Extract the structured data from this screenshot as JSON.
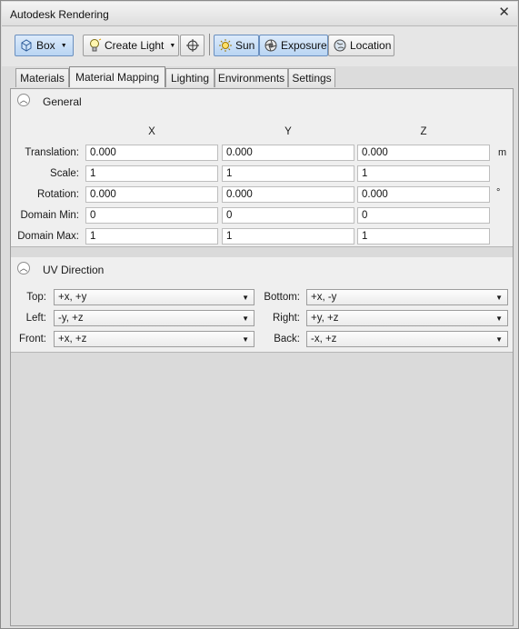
{
  "window": {
    "title": "Autodesk Rendering",
    "close_glyph": "✕"
  },
  "toolbar": {
    "box": {
      "label": "Box",
      "icon": "box-icon"
    },
    "create_light": {
      "label": "Create Light",
      "icon": "light-bulb-icon"
    },
    "target": {
      "icon": "crosshair-icon"
    },
    "sun": {
      "label": "Sun",
      "icon": "sun-icon"
    },
    "exposure": {
      "label": "Exposure",
      "icon": "exposure-icon"
    },
    "location": {
      "label": "Location",
      "icon": "globe-icon"
    }
  },
  "tabs": [
    {
      "label": "Materials",
      "selected": false
    },
    {
      "label": "Material Mapping",
      "selected": true
    },
    {
      "label": "Lighting",
      "selected": false
    },
    {
      "label": "Environments",
      "selected": false
    },
    {
      "label": "Settings",
      "selected": false
    }
  ],
  "general": {
    "title": "General",
    "axes": [
      "X",
      "Y",
      "Z"
    ],
    "rows": [
      {
        "label": "Translation:",
        "values": [
          "0.000",
          "0.000",
          "0.000"
        ],
        "unit": "m"
      },
      {
        "label": "Scale:",
        "values": [
          "1",
          "1",
          "1"
        ],
        "unit": ""
      },
      {
        "label": "Rotation:",
        "values": [
          "0.000",
          "0.000",
          "0.000"
        ],
        "unit": "°"
      },
      {
        "label": "Domain Min:",
        "values": [
          "0",
          "0",
          "0"
        ],
        "unit": ""
      },
      {
        "label": "Domain Max:",
        "values": [
          "1",
          "1",
          "1"
        ],
        "unit": ""
      }
    ]
  },
  "uv": {
    "title": "UV Direction",
    "top": {
      "label": "Top:",
      "value": "+x, +y"
    },
    "bottom": {
      "label": "Bottom:",
      "value": "+x, -y"
    },
    "left": {
      "label": "Left:",
      "value": "-y, +z"
    },
    "right": {
      "label": "Right:",
      "value": "+y, +z"
    },
    "front": {
      "label": "Front:",
      "value": "+x, +z"
    },
    "back": {
      "label": "Back:",
      "value": "-x, +z"
    }
  },
  "colors": {
    "active_button": "#b9d5f3",
    "panel_bg": "#efefef"
  }
}
